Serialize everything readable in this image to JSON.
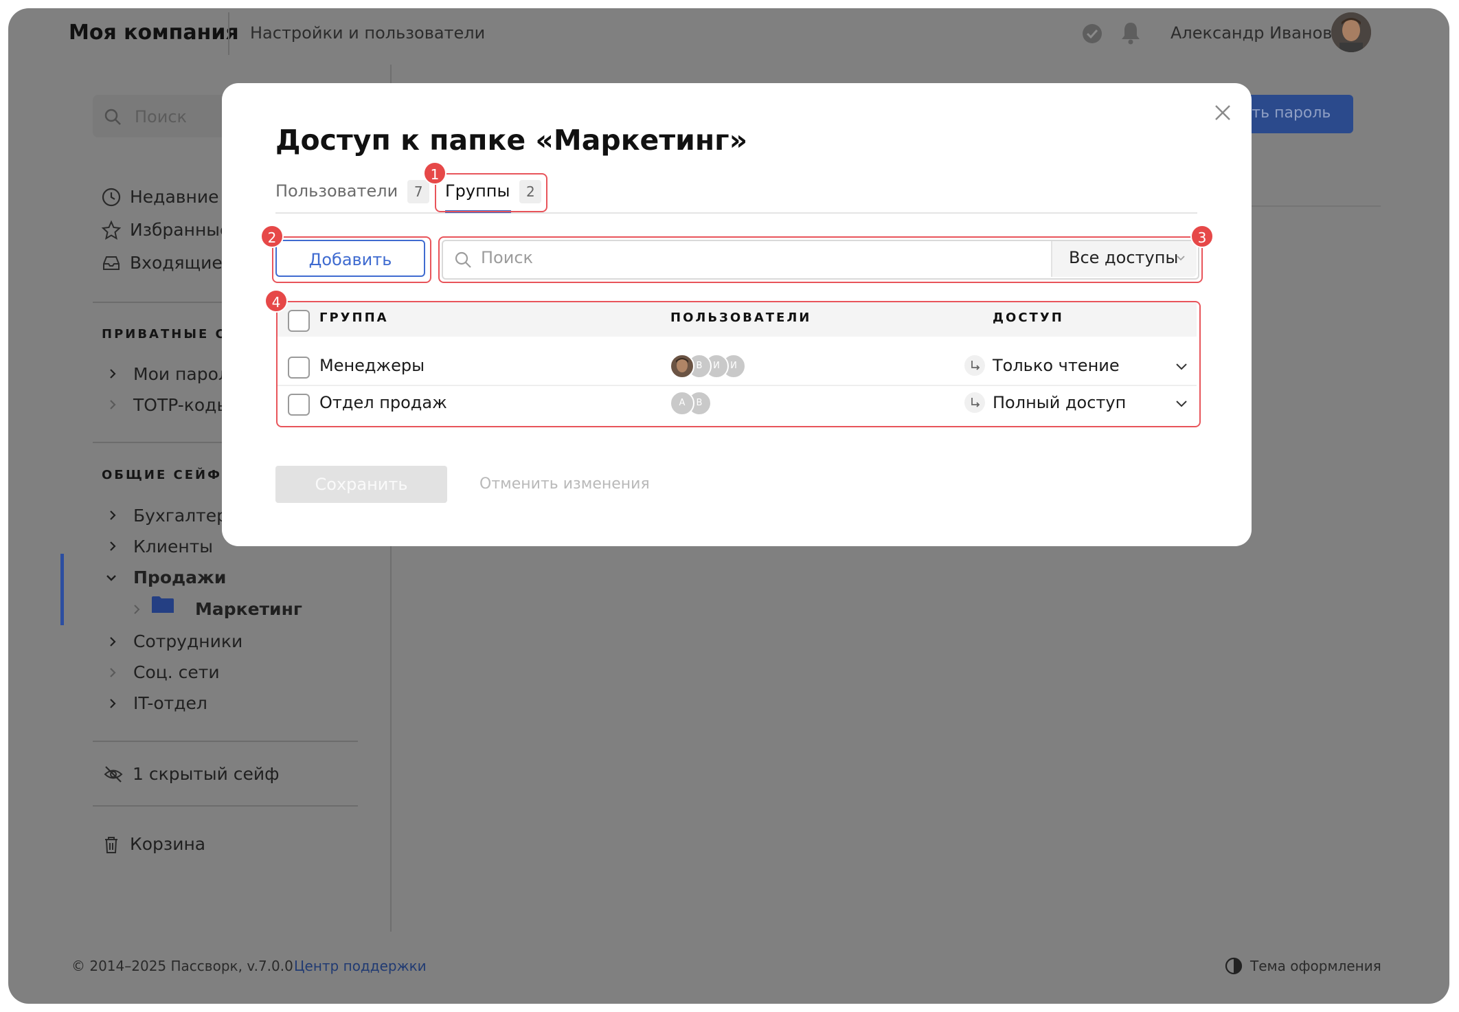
{
  "app": {
    "company": "Моя компания",
    "nav_title": "Настройки и пользователи",
    "user_name": "Александр Иванов"
  },
  "sidebar": {
    "search_placeholder": "Поиск",
    "quick": [
      {
        "label": "Недавние",
        "icon": "clock-icon"
      },
      {
        "label": "Избранные",
        "icon": "star-icon"
      },
      {
        "label": "Входящие",
        "icon": "inbox-icon"
      }
    ],
    "private_heading": "ПРИВАТНЫЕ СЕЙ",
    "private_items": [
      "Мои парол",
      "TOTP-коды"
    ],
    "shared_heading": "ОБЩИЕ СЕЙФЫ",
    "shared_items": [
      "Бухгалтери",
      "Клиенты",
      "Продажи",
      "Маркетинг",
      "Сотрудники",
      "Соц. сети",
      "IT-отдел"
    ],
    "hidden_vaults": "1 скрытый сейф",
    "trash": "Корзина"
  },
  "header_button": "ить пароль",
  "footer": {
    "copyright": "© 2014–2025 Пассворк, v.7.0.0",
    "support": "Центр поддержки",
    "theme": "Тема оформления"
  },
  "modal": {
    "title": "Доступ к папке «Маркетинг»",
    "tabs": [
      {
        "label": "Пользователи",
        "count": "7"
      },
      {
        "label": "Группы",
        "count": "2",
        "active": true
      }
    ],
    "add_button": "Добавить",
    "search_placeholder": "Поиск",
    "filter_label": "Все доступы",
    "columns": {
      "group": "ГРУППА",
      "users": "ПОЛЬЗОВАТЕЛИ",
      "access": "ДОСТУП"
    },
    "rows": [
      {
        "name": "Менеджеры",
        "avatars": [
          "photo",
          "В",
          "И",
          "И"
        ],
        "access": "Только чтение"
      },
      {
        "name": "Отдел продаж",
        "avatars": [
          "А",
          "В"
        ],
        "access": "Полный доступ"
      }
    ],
    "save_button": "Сохранить",
    "cancel_link": "Отменить изменения"
  },
  "annotations": [
    "1",
    "2",
    "3",
    "4"
  ],
  "colors": {
    "accent": "#3465c6",
    "annotation": "#e64848",
    "overlay": "#808080"
  }
}
